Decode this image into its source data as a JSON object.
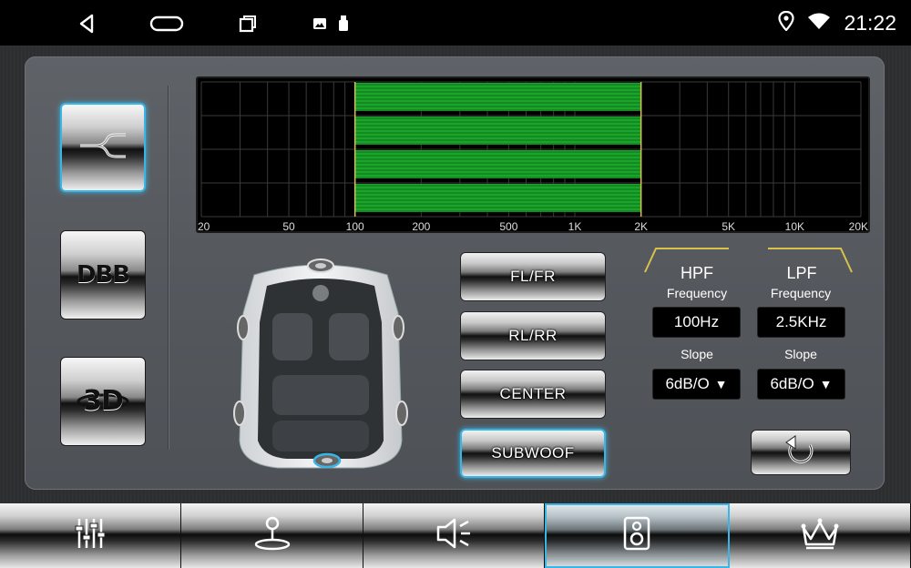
{
  "status": {
    "time": "21:22",
    "icons": [
      "back-icon",
      "home-icon",
      "recents-icon",
      "gallery-icon",
      "usb-icon",
      "location-icon",
      "wifi-icon"
    ]
  },
  "modes": [
    {
      "id": "crossover",
      "label": "",
      "icon": "crossover-icon",
      "active": true
    },
    {
      "id": "dbb",
      "label": "DBB",
      "active": false
    },
    {
      "id": "3d",
      "label": "3D",
      "active": false
    }
  ],
  "graph": {
    "x_ticks": [
      "20",
      "50",
      "100",
      "200",
      "500",
      "1K",
      "2K",
      "5K",
      "10K",
      "20K"
    ],
    "passband": {
      "from": "100",
      "to": "2K"
    },
    "band_color": "#1aa52a"
  },
  "channels": [
    {
      "label": "FL/FR",
      "active": false
    },
    {
      "label": "RL/RR",
      "active": false
    },
    {
      "label": "CENTER",
      "active": false
    },
    {
      "label": "SUBWOOF",
      "active": true
    }
  ],
  "hpf": {
    "title": "HPF",
    "freq_label": "Frequency",
    "freq_value": "100Hz",
    "slope_label": "Slope",
    "slope_value": "6dB/O"
  },
  "lpf": {
    "title": "LPF",
    "freq_label": "Frequency",
    "freq_value": "2.5KHz",
    "slope_label": "Slope",
    "slope_value": "6dB/O"
  },
  "tabs": [
    {
      "icon": "equalizer-icon",
      "active": false
    },
    {
      "icon": "joystick-balance-icon",
      "active": false
    },
    {
      "icon": "speaker-volume-icon",
      "active": false
    },
    {
      "icon": "subwoofer-speaker-icon",
      "active": true
    },
    {
      "icon": "crown-icon",
      "active": false
    }
  ],
  "accent": "#39b6e6"
}
